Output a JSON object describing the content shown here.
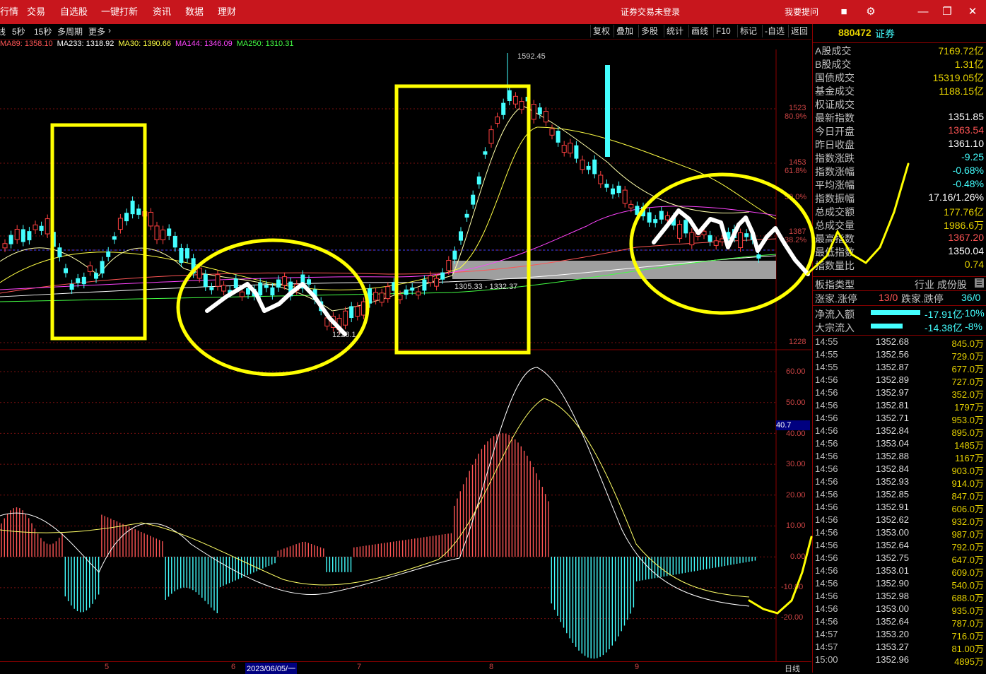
{
  "topbar": {
    "menu": [
      "行情",
      "交易",
      "自选股",
      "一键打新",
      "资讯",
      "数据",
      "理财"
    ],
    "login_status": "证券交易未登录",
    "help": "我要提问",
    "icons": [
      "cube-icon",
      "gear-icon",
      "minimize-icon",
      "restore-icon",
      "close-icon"
    ]
  },
  "toolbar": {
    "left": [
      "线",
      "5秒",
      "15秒",
      "多周期",
      "更多"
    ],
    "right": [
      "复权",
      "叠加",
      "多股",
      "统计",
      "画线",
      "F10",
      "标记",
      "-自选",
      "返回"
    ]
  },
  "ma_legend": [
    {
      "text": "MA89: 1358.10",
      "color": "#ff5555"
    },
    {
      "text": "MA233: 1318.92",
      "color": "#ffffff"
    },
    {
      "text": "MA30: 1390.66",
      "color": "#ffff44"
    },
    {
      "text": "MA144: 1346.09",
      "color": "#ff44ff"
    },
    {
      "text": "MA250: 1310.31",
      "color": "#44ff44"
    }
  ],
  "price_axis": [
    "1523",
    "80.9%",
    "1453",
    "61.8%",
    "50.0%",
    "1387",
    "38.2%",
    "1228"
  ],
  "price_annotations": {
    "high": "1592.45",
    "range": "1305.33 - 1332.37",
    "low": "1228.1"
  },
  "macd_axis": [
    "60.00",
    "50.00",
    "40.00",
    "30.00",
    "20.00",
    "10.00",
    "0.00",
    "-10.00",
    "-20.00"
  ],
  "macd_current": "40.7",
  "date_axis": [
    "5",
    "6",
    "2023/06/05/一",
    "7",
    "8",
    "9"
  ],
  "period_label": "日线",
  "info": {
    "code": "880472",
    "name": "证券",
    "rows": [
      {
        "k": "A股成交",
        "v": "7169.72亿",
        "c": "#e6d200"
      },
      {
        "k": "B股成交",
        "v": "1.31亿",
        "c": "#e6d200"
      },
      {
        "k": "国债成交",
        "v": "15319.05亿",
        "c": "#e6d200"
      },
      {
        "k": "基金成交",
        "v": "1188.15亿",
        "c": "#e6d200"
      },
      {
        "k": "权证成交",
        "v": "",
        "c": "#e6d200"
      },
      {
        "k": "最新指数",
        "v": "1351.85",
        "c": "#ffffff"
      },
      {
        "k": "今日开盘",
        "v": "1363.54",
        "c": "#ff5555"
      },
      {
        "k": "昨日收盘",
        "v": "1361.10",
        "c": "#ffffff"
      },
      {
        "k": "指数涨跌",
        "v": "-9.25",
        "c": "#44ffff"
      },
      {
        "k": "指数涨幅",
        "v": "-0.68%",
        "c": "#44ffff"
      },
      {
        "k": "平均涨幅",
        "v": "-0.48%",
        "c": "#44ffff"
      },
      {
        "k": "指数振幅",
        "v": "17.16/1.26%",
        "c": "#ffffff"
      },
      {
        "k": "总成交额",
        "v": "177.76亿",
        "c": "#e6d200"
      },
      {
        "k": "总成交量",
        "v": "1986.6万",
        "c": "#e6d200"
      },
      {
        "k": "最高指数",
        "v": "1367.20",
        "c": "#ff5555"
      },
      {
        "k": "最低指数",
        "v": "1350.04",
        "c": "#ffffff"
      },
      {
        "k": "指数量比",
        "v": "0.74",
        "c": "#e6d200"
      }
    ],
    "type_label": "板指类型",
    "type_value": "行业 成份股",
    "limit_label": "涨家.涨停",
    "limit_value": "13/0",
    "down_label": "跌家.跌停",
    "down_value": "36/0",
    "flow": [
      {
        "k": "净流入额",
        "v": "-17.91亿",
        "pct": "-10%"
      },
      {
        "k": "大宗流入",
        "v": "-14.38亿",
        "pct": "-8%"
      }
    ]
  },
  "ticks": [
    {
      "t": "14:55",
      "p": "1352.68",
      "v": "845.0万"
    },
    {
      "t": "14:55",
      "p": "1352.56",
      "v": "729.0万"
    },
    {
      "t": "14:55",
      "p": "1352.87",
      "v": "677.0万"
    },
    {
      "t": "14:56",
      "p": "1352.89",
      "v": "727.0万"
    },
    {
      "t": "14:56",
      "p": "1352.97",
      "v": "352.0万"
    },
    {
      "t": "14:56",
      "p": "1352.81",
      "v": "1797万"
    },
    {
      "t": "14:56",
      "p": "1352.71",
      "v": "953.0万"
    },
    {
      "t": "14:56",
      "p": "1352.84",
      "v": "895.0万"
    },
    {
      "t": "14:56",
      "p": "1353.04",
      "v": "1485万"
    },
    {
      "t": "14:56",
      "p": "1352.88",
      "v": "1167万"
    },
    {
      "t": "14:56",
      "p": "1352.84",
      "v": "903.0万"
    },
    {
      "t": "14:56",
      "p": "1352.93",
      "v": "914.0万"
    },
    {
      "t": "14:56",
      "p": "1352.85",
      "v": "847.0万"
    },
    {
      "t": "14:56",
      "p": "1352.91",
      "v": "606.0万"
    },
    {
      "t": "14:56",
      "p": "1352.62",
      "v": "932.0万"
    },
    {
      "t": "14:56",
      "p": "1353.00",
      "v": "987.0万"
    },
    {
      "t": "14:56",
      "p": "1352.64",
      "v": "792.0万"
    },
    {
      "t": "14:56",
      "p": "1352.75",
      "v": "647.0万"
    },
    {
      "t": "14:56",
      "p": "1353.01",
      "v": "609.0万"
    },
    {
      "t": "14:56",
      "p": "1352.90",
      "v": "540.0万"
    },
    {
      "t": "14:56",
      "p": "1352.98",
      "v": "688.0万"
    },
    {
      "t": "14:56",
      "p": "1353.00",
      "v": "935.0万"
    },
    {
      "t": "14:56",
      "p": "1352.64",
      "v": "787.0万"
    },
    {
      "t": "14:57",
      "p": "1353.20",
      "v": "716.0万"
    },
    {
      "t": "14:57",
      "p": "1353.27",
      "v": "81.00万"
    },
    {
      "t": "15:00",
      "p": "1352.96",
      "v": "4895万"
    }
  ],
  "colors": {
    "up": "#ff3333",
    "down": "#44ffff",
    "highlight": "#ffff00",
    "bar": "#c8161d"
  }
}
